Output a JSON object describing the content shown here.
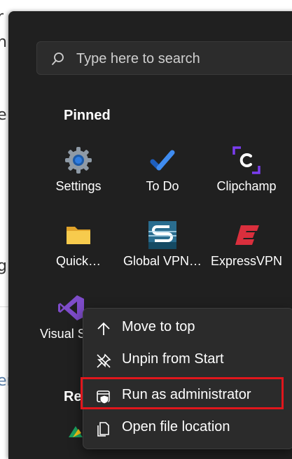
{
  "background": {
    "fragments": [
      "r",
      "n",
      "e",
      "g",
      "er"
    ]
  },
  "search": {
    "placeholder": "Type here to search"
  },
  "pinned": {
    "title": "Pinned",
    "apps": [
      {
        "label": "Settings",
        "icon": "settings-gear-icon"
      },
      {
        "label": "To Do",
        "icon": "todo-check-icon"
      },
      {
        "label": "Clipchamp",
        "icon": "clipchamp-icon"
      },
      {
        "label": "Quick…",
        "icon": "folder-icon"
      },
      {
        "label": "Global VPN…",
        "icon": "global-vpn-icon"
      },
      {
        "label": "ExpressVPN",
        "icon": "expressvpn-icon"
      },
      {
        "label": "Visual S",
        "icon": "visual-studio-icon"
      }
    ]
  },
  "recommended": {
    "title": "Re"
  },
  "context_menu": {
    "items": [
      {
        "label": "Move to top",
        "icon": "arrow-up-icon"
      },
      {
        "label": "Unpin from Start",
        "icon": "unpin-icon"
      },
      {
        "label": "Run as administrator",
        "icon": "shield-window-icon",
        "highlighted": true
      },
      {
        "label": "Open file location",
        "icon": "file-location-icon"
      }
    ]
  },
  "colors": {
    "menu_bg": "#202020",
    "context_bg": "#2b2b2b",
    "highlight_border": "#e0161c",
    "accent_blue": "#2f7de1"
  }
}
